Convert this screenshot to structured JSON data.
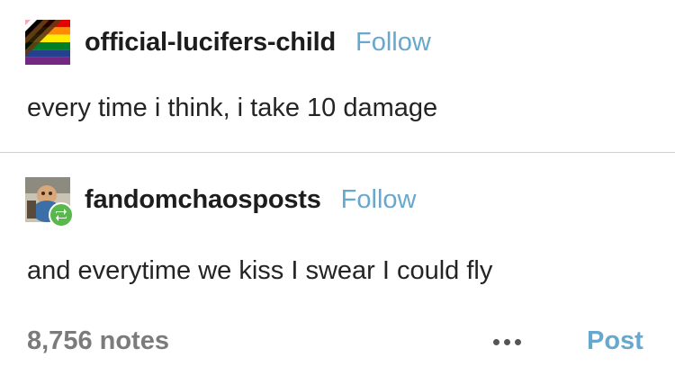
{
  "posts": [
    {
      "username": "official-lucifers-child",
      "follow_label": "Follow",
      "text": "every time i think, i take 10 damage"
    },
    {
      "username": "fandomchaosposts",
      "follow_label": "Follow",
      "text": "and everytime we kiss I swear I could fly"
    }
  ],
  "footer": {
    "notes": "8,756 notes",
    "post_label": "Post"
  },
  "colors": {
    "follow_link": "#67a8cf",
    "reblog_badge": "#58b84b",
    "notes_text": "#7b7b7b"
  },
  "icons": {
    "avatar_1": "progress-pride-flag-avatar",
    "avatar_2": "photo-avatar",
    "badge": "reblog-icon",
    "more": "more-options-icon"
  }
}
